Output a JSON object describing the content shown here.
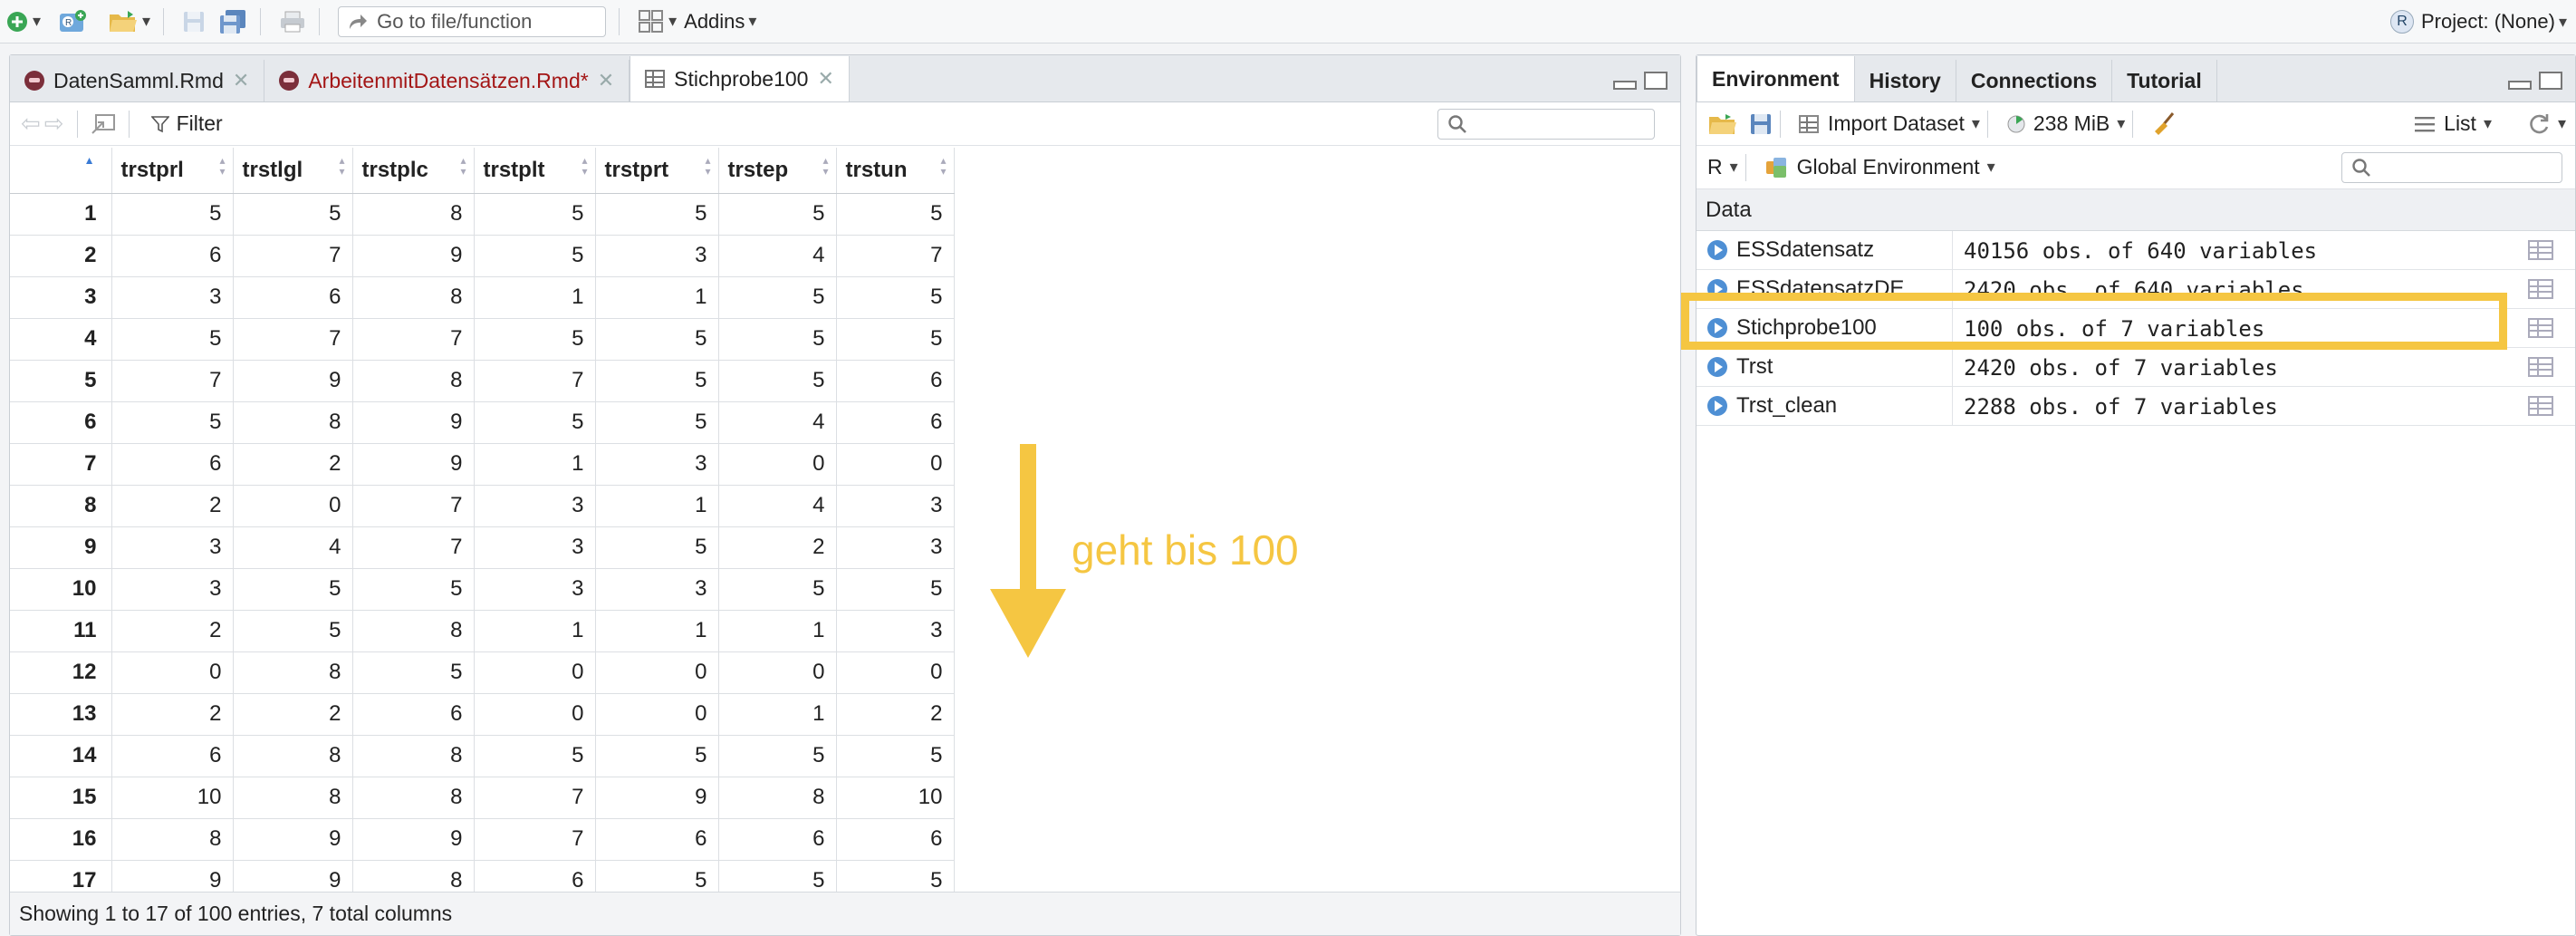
{
  "toolbar": {
    "goto_placeholder": "Go to file/function",
    "addins_label": "Addins",
    "project_label": "Project: (None)",
    "project_icon_text": "R"
  },
  "editor": {
    "tabs": [
      {
        "label": "DatenSamml.Rmd",
        "modified": false
      },
      {
        "label": "ArbeitenmitDatensätzen.Rmd*",
        "modified": true
      },
      {
        "label": "Stichprobe100",
        "active": true
      }
    ],
    "filter_label": "Filter",
    "columns": [
      "",
      "trstprl",
      "trstlgl",
      "trstplc",
      "trstplt",
      "trstprt",
      "trstep",
      "trstun"
    ],
    "rows": [
      [
        "1",
        "5",
        "5",
        "8",
        "5",
        "5",
        "5",
        "5"
      ],
      [
        "2",
        "6",
        "7",
        "9",
        "5",
        "3",
        "4",
        "7"
      ],
      [
        "3",
        "3",
        "6",
        "8",
        "1",
        "1",
        "5",
        "5"
      ],
      [
        "4",
        "5",
        "7",
        "7",
        "5",
        "5",
        "5",
        "5"
      ],
      [
        "5",
        "7",
        "9",
        "8",
        "7",
        "5",
        "5",
        "6"
      ],
      [
        "6",
        "5",
        "8",
        "9",
        "5",
        "5",
        "4",
        "6"
      ],
      [
        "7",
        "6",
        "2",
        "9",
        "1",
        "3",
        "0",
        "0"
      ],
      [
        "8",
        "2",
        "0",
        "7",
        "3",
        "1",
        "4",
        "3"
      ],
      [
        "9",
        "3",
        "4",
        "7",
        "3",
        "5",
        "2",
        "3"
      ],
      [
        "10",
        "3",
        "5",
        "5",
        "3",
        "3",
        "5",
        "5"
      ],
      [
        "11",
        "2",
        "5",
        "8",
        "1",
        "1",
        "1",
        "3"
      ],
      [
        "12",
        "0",
        "8",
        "5",
        "0",
        "0",
        "0",
        "0"
      ],
      [
        "13",
        "2",
        "2",
        "6",
        "0",
        "0",
        "1",
        "2"
      ],
      [
        "14",
        "6",
        "8",
        "8",
        "5",
        "5",
        "5",
        "5"
      ],
      [
        "15",
        "10",
        "8",
        "8",
        "7",
        "9",
        "8",
        "10"
      ],
      [
        "16",
        "8",
        "9",
        "9",
        "7",
        "6",
        "6",
        "6"
      ],
      [
        "17",
        "9",
        "9",
        "8",
        "6",
        "5",
        "5",
        "5"
      ]
    ],
    "status": "Showing 1 to 17 of 100 entries, 7 total columns"
  },
  "annotation": {
    "text": "geht bis 100",
    "color": "#f5c642"
  },
  "environment": {
    "tabs": [
      "Environment",
      "History",
      "Connections",
      "Tutorial"
    ],
    "import_label": "Import Dataset",
    "memory_label": "238 MiB",
    "list_label": "List",
    "lang_label": "R",
    "scope_label": "Global Environment",
    "data_header": "Data",
    "objects": [
      {
        "name": "ESSdatensatz",
        "value": "40156 obs. of 640 variables"
      },
      {
        "name": "ESSdatensatzDE",
        "value": "2420 obs. of 640 variables"
      },
      {
        "name": "Stichprobe100",
        "value": "100 obs. of 7 variables"
      },
      {
        "name": "Trst",
        "value": "2420 obs. of 7 variables"
      },
      {
        "name": "Trst_clean",
        "value": "2288 obs. of 7 variables"
      }
    ]
  }
}
